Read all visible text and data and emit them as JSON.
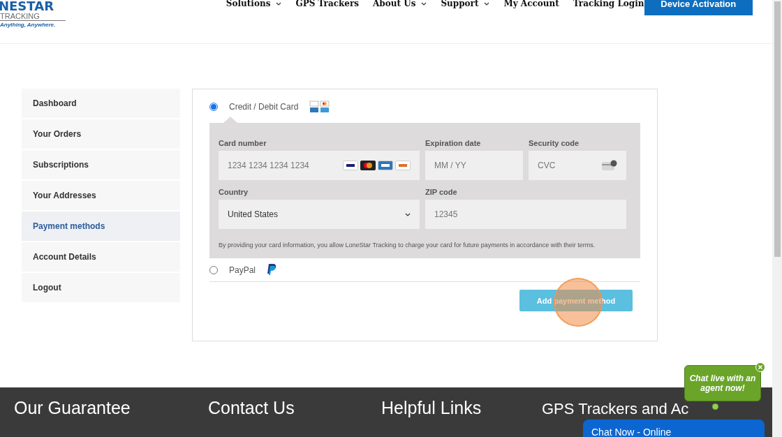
{
  "header": {
    "logo": {
      "name": "NESTAR",
      "sub": "TRACKING",
      "tagline": "Anything, Anywhere."
    },
    "nav": [
      {
        "label": "Solutions",
        "dropdown": true
      },
      {
        "label": "GPS Trackers",
        "dropdown": false
      },
      {
        "label": "About Us",
        "dropdown": true
      },
      {
        "label": "Support",
        "dropdown": true
      },
      {
        "label": "My Account",
        "dropdown": false
      },
      {
        "label": "Tracking Login",
        "dropdown": false
      }
    ],
    "cta": "Device Activation"
  },
  "sidebar": {
    "items": [
      {
        "label": "Dashboard",
        "selected": false
      },
      {
        "label": "Your Orders",
        "selected": false
      },
      {
        "label": "Subscriptions",
        "selected": false
      },
      {
        "label": "Your Addresses",
        "selected": false
      },
      {
        "label": "Payment methods",
        "selected": true
      },
      {
        "label": "Account Details",
        "selected": false
      },
      {
        "label": "Logout",
        "selected": false
      }
    ]
  },
  "payment": {
    "methods": [
      {
        "kind": "card",
        "label": "Credit / Debit Card",
        "selected": true
      },
      {
        "kind": "paypal",
        "label": "PayPal",
        "selected": false
      }
    ],
    "card_form": {
      "card_number": {
        "label": "Card number",
        "placeholder": "1234 1234 1234 1234"
      },
      "expiration": {
        "label": "Expiration date",
        "placeholder": "MM / YY"
      },
      "security": {
        "label": "Security code",
        "placeholder": "CVC"
      },
      "country": {
        "label": "Country",
        "value": "United States"
      },
      "zip": {
        "label": "ZIP code",
        "placeholder": "12345"
      },
      "notice": "By providing your card information, you allow LoneStar Tracking to charge your card for future payments in accordance with their terms."
    },
    "submit": "Add payment method"
  },
  "footer": {
    "headings": [
      "Our Guarantee",
      "Contact Us",
      "Helpful Links",
      "GPS Trackers and Ac"
    ]
  },
  "chat": {
    "bubble": "Chat live with an agent now!",
    "bar": "Chat Now - Online"
  }
}
